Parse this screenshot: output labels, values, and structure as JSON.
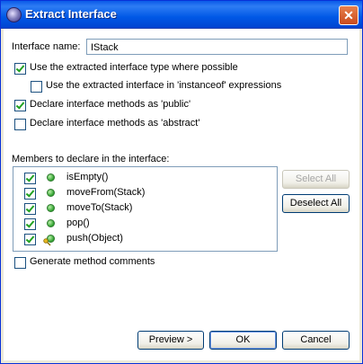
{
  "window": {
    "title": "Extract Interface",
    "close_glyph": "✕"
  },
  "interface_name": {
    "label": "Interface name:",
    "value": "IStack"
  },
  "options": {
    "use_extracted_type": {
      "label": "Use the extracted interface type where possible",
      "checked": true
    },
    "use_in_instanceof": {
      "label": "Use the extracted interface in 'instanceof' expressions",
      "checked": false
    },
    "declare_public": {
      "label": "Declare interface methods as 'public'",
      "checked": true
    },
    "declare_abstract": {
      "label": "Declare interface methods as 'abstract'",
      "checked": false
    }
  },
  "members": {
    "label": "Members to declare in the interface:",
    "items": [
      {
        "name": "isEmpty()",
        "checked": true,
        "icon": "public-method-icon"
      },
      {
        "name": "moveFrom(Stack)",
        "checked": true,
        "icon": "public-method-icon"
      },
      {
        "name": "moveTo(Stack)",
        "checked": true,
        "icon": "public-method-icon"
      },
      {
        "name": "pop()",
        "checked": true,
        "icon": "public-method-icon"
      },
      {
        "name": "push(Object)",
        "checked": true,
        "icon": "public-method-with-key-icon"
      }
    ],
    "select_all": "Select All",
    "deselect_all": "Deselect All"
  },
  "generate_comments": {
    "label": "Generate method comments",
    "checked": false
  },
  "buttons": {
    "preview": "Preview >",
    "ok": "OK",
    "cancel": "Cancel"
  }
}
